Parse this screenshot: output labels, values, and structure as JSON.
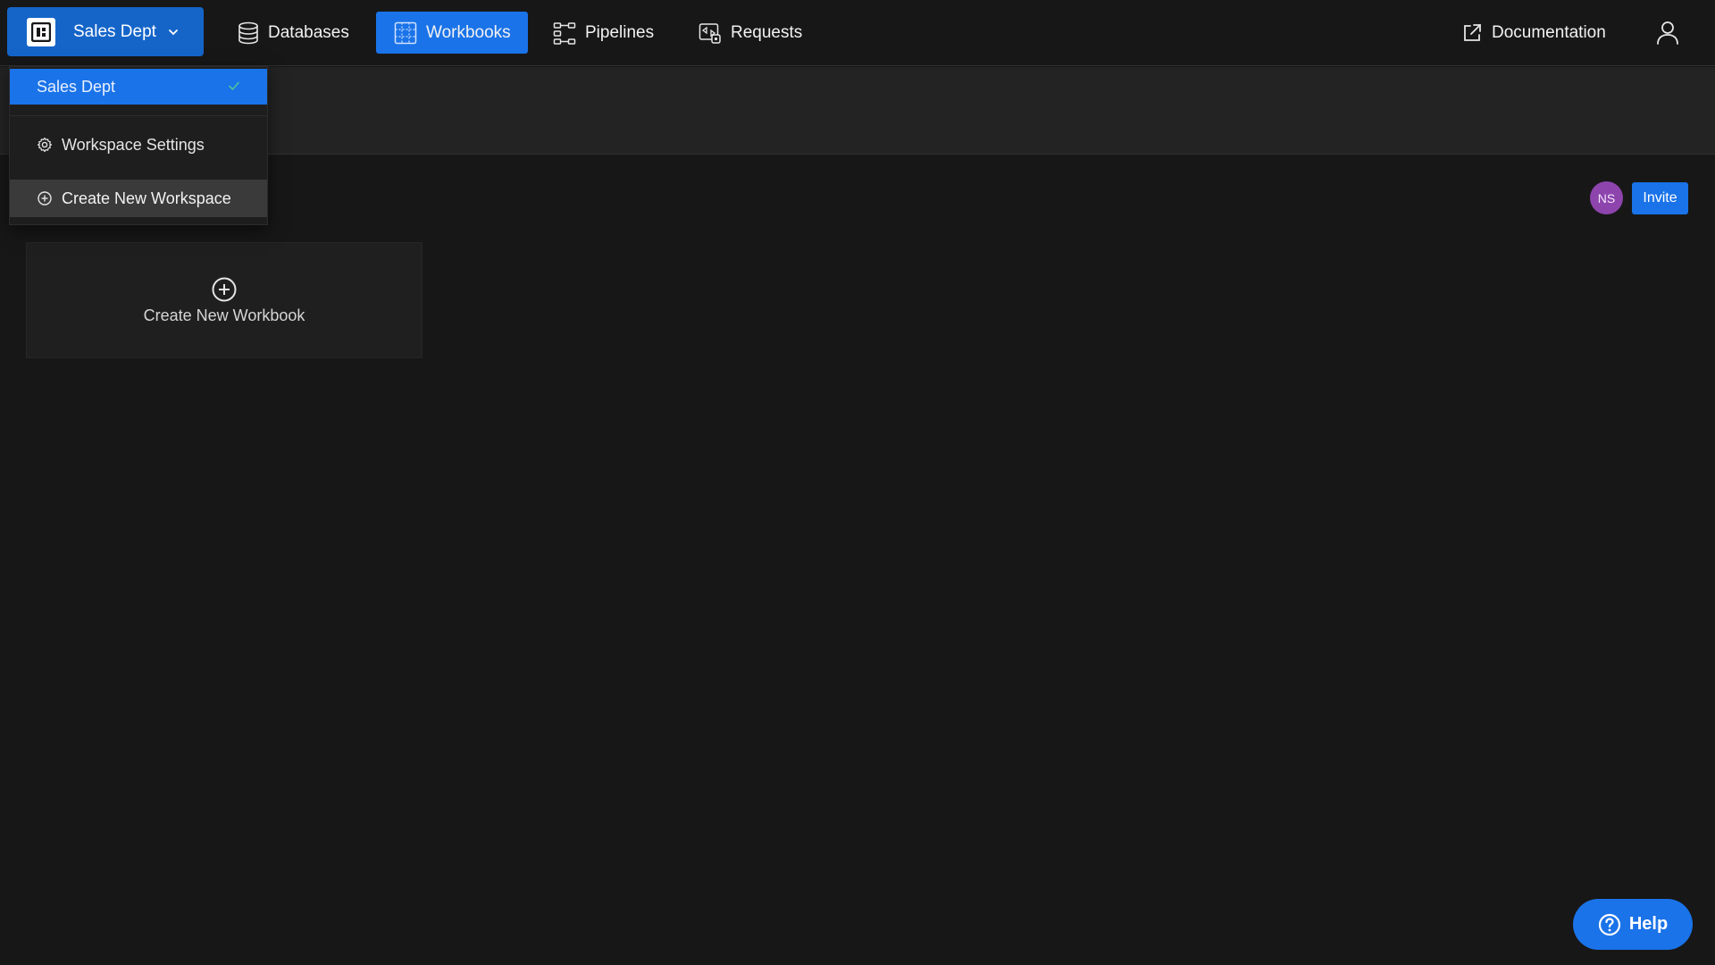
{
  "workspace": {
    "current": "Sales Dept"
  },
  "nav": {
    "databases": "Databases",
    "workbooks": "Workbooks",
    "pipelines": "Pipelines",
    "requests": "Requests",
    "documentation": "Documentation"
  },
  "dropdown": {
    "selected": "Sales Dept",
    "settings": "Workspace Settings",
    "create": "Create New Workspace"
  },
  "members": {
    "initials": "NS",
    "invite": "Invite"
  },
  "workbooks": {
    "create_label": "Create New Workbook"
  },
  "help": {
    "label": "Help"
  },
  "colors": {
    "accent": "#1a73e8",
    "workspace_button": "#1565c9",
    "background": "#171717",
    "avatar": "#8e44ad"
  },
  "icons": {
    "workspace_logo": "workspace-logo-icon",
    "databases": "database-icon",
    "workbooks": "spreadsheet-icon",
    "pipelines": "pipeline-icon",
    "requests": "requests-icon",
    "documentation": "external-link-icon",
    "user": "user-icon",
    "settings": "gear-icon",
    "create": "plus-circle-icon",
    "help": "question-icon"
  }
}
